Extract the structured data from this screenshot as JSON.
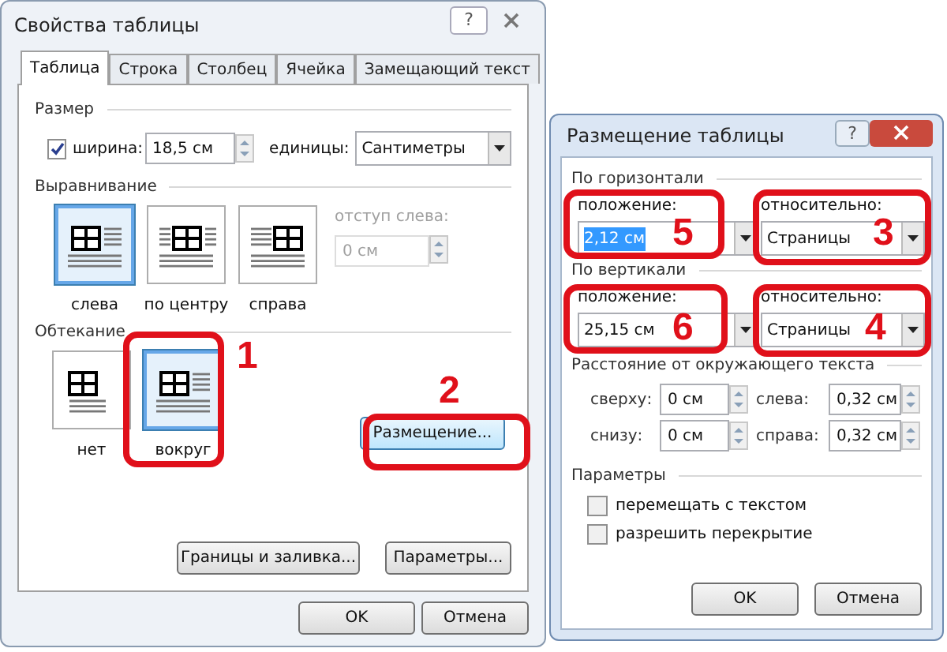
{
  "table_properties": {
    "title": "Свойства таблицы",
    "help": "?",
    "tabs": [
      {
        "label": "Таблица",
        "selected": true
      },
      {
        "label": "Строка",
        "selected": false
      },
      {
        "label": "Столбец",
        "selected": false
      },
      {
        "label": "Ячейка",
        "selected": false
      },
      {
        "label": "Замещающий текст",
        "selected": false
      }
    ],
    "size": {
      "section": "Размер",
      "width_checked": true,
      "width_label": "ширина:",
      "width_value": "18,5 см",
      "units_label": "единицы:",
      "units_value": "Сантиметры"
    },
    "alignment": {
      "section": "Выравнивание",
      "options": [
        {
          "kind": "left",
          "label": "слева",
          "selected": true
        },
        {
          "kind": "center",
          "label": "по центру",
          "selected": false
        },
        {
          "kind": "right",
          "label": "справа",
          "selected": false
        }
      ],
      "indent_label": "отступ слева:",
      "indent_value": "0 см",
      "indent_disabled": true
    },
    "wrapping": {
      "section": "Обтекание",
      "options": [
        {
          "kind": "none",
          "label": "нет",
          "selected": false
        },
        {
          "kind": "around",
          "label": "вокруг",
          "selected": true
        }
      ],
      "placement_button": "Размещение..."
    },
    "buttons": [
      "Границы и заливка...",
      "Параметры..."
    ],
    "dialog_buttons": [
      "OK",
      "Отмена"
    ]
  },
  "table_positioning": {
    "title": "Размещение таблицы",
    "help": "?",
    "horizontal": {
      "section": "По горизонтали",
      "position_label": "положение:",
      "position_value": "2,12 см",
      "relative_label": "относительно:",
      "relative_value": "Страницы"
    },
    "vertical": {
      "section": "По вертикали",
      "position_label": "положение:",
      "position_value": "25,15 см",
      "relative_label": "относительно:",
      "relative_value": "Страницы"
    },
    "distance": {
      "section": "Расстояние от окружающего текста",
      "fields": [
        {
          "label": "сверху:",
          "value": "0 см"
        },
        {
          "label": "слева:",
          "value": "0,32 см"
        },
        {
          "label": "снизу:",
          "value": "0 см"
        },
        {
          "label": "справа:",
          "value": "0,32 см"
        }
      ]
    },
    "options": {
      "section": "Параметры",
      "items": [
        {
          "label": "перемещать с текстом",
          "checked": false
        },
        {
          "label": "разрешить перекрытие",
          "checked": false
        }
      ]
    },
    "dialog_buttons": [
      "OK",
      "Отмена"
    ]
  },
  "annotations": [
    {
      "label": "1"
    },
    {
      "label": "2"
    },
    {
      "label": "3"
    },
    {
      "label": "4"
    },
    {
      "label": "5"
    },
    {
      "label": "6"
    }
  ]
}
